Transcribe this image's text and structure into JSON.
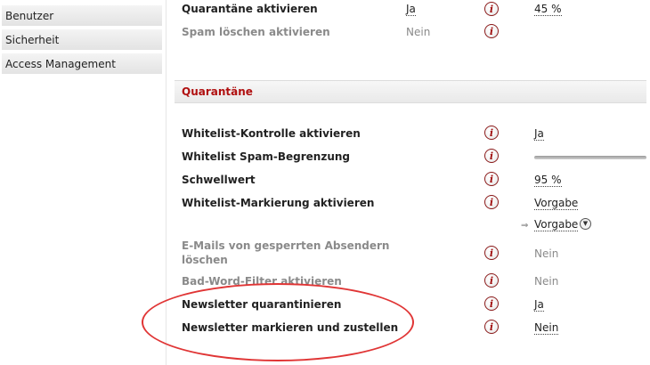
{
  "sidebar": {
    "items": [
      {
        "label": "Benutzer"
      },
      {
        "label": "Sicherheit"
      },
      {
        "label": "Access Management"
      }
    ]
  },
  "top_rows": [
    {
      "label": "Quarantäne aktivieren",
      "value": "Ja",
      "extra": "45 %"
    },
    {
      "label": "Spam löschen aktivieren",
      "value": "Nein"
    }
  ],
  "section": {
    "title": "Quarantäne",
    "rows": [
      {
        "label": "Whitelist-Kontrolle aktivieren",
        "value": "Ja"
      },
      {
        "label": "Whitelist Spam-Begrenzung",
        "value": ""
      },
      {
        "label": "Schwellwert",
        "value": "95 %"
      },
      {
        "label": "Whitelist-Markierung aktivieren",
        "value": "Vorgabe"
      },
      {
        "sub_value": "Vorgabe"
      },
      {
        "label_line1": "E-Mails von gesperrten Absendern",
        "label_line2": "löschen",
        "value": "Nein"
      },
      {
        "label": "Bad-Word-Filter aktivieren",
        "value": "Nein"
      },
      {
        "label": "Newsletter quarantinieren",
        "value": "Ja"
      },
      {
        "label": "Newsletter markieren und zustellen",
        "value": "Nein"
      }
    ]
  },
  "info_icon_glyph": "i",
  "arrow_glyph": "⇒",
  "dropdown_glyph": "▼",
  "colors": {
    "section_title": "#b01010",
    "highlight": "#e03535",
    "info_icon": "#a01010"
  }
}
